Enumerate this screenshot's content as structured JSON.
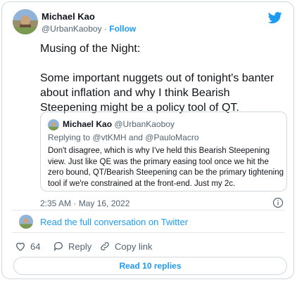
{
  "author": {
    "name": "Michael Kao",
    "handle": "@UrbanKaoboy",
    "separator": "·",
    "follow_label": "Follow"
  },
  "tweet": {
    "paragraph1": "Musing of the Night:",
    "paragraph2": "Some important nuggets out of tonight's banter about inflation and why I think Bearish Steepening might be a policy tool of QT."
  },
  "quoted": {
    "name": "Michael Kao",
    "handle": "@UrbanKaoboy",
    "replying_prefix": "Replying to",
    "mention1": "@vtKMH",
    "conjunction": "and",
    "mention2": "@PauloMacro",
    "text": "Don't disagree, which is why I've held this Bearish Steepening view. Just like QE was the primary easing tool once we hit the zero bound, QT/Bearish Steepening can be the primary tightening tool if we're constrained at the front-end. Just my 2c."
  },
  "timestamp": "2:35 AM · May 16, 2022",
  "read_full_label": "Read the full conversation on Twitter",
  "actions": {
    "like_count": "64",
    "reply_label": "Reply",
    "copy_label": "Copy link"
  },
  "read_replies_label": "Read 10 replies",
  "colors": {
    "accent": "#1d9bf0",
    "secondary_text": "#536471",
    "border": "#cfd9de"
  }
}
